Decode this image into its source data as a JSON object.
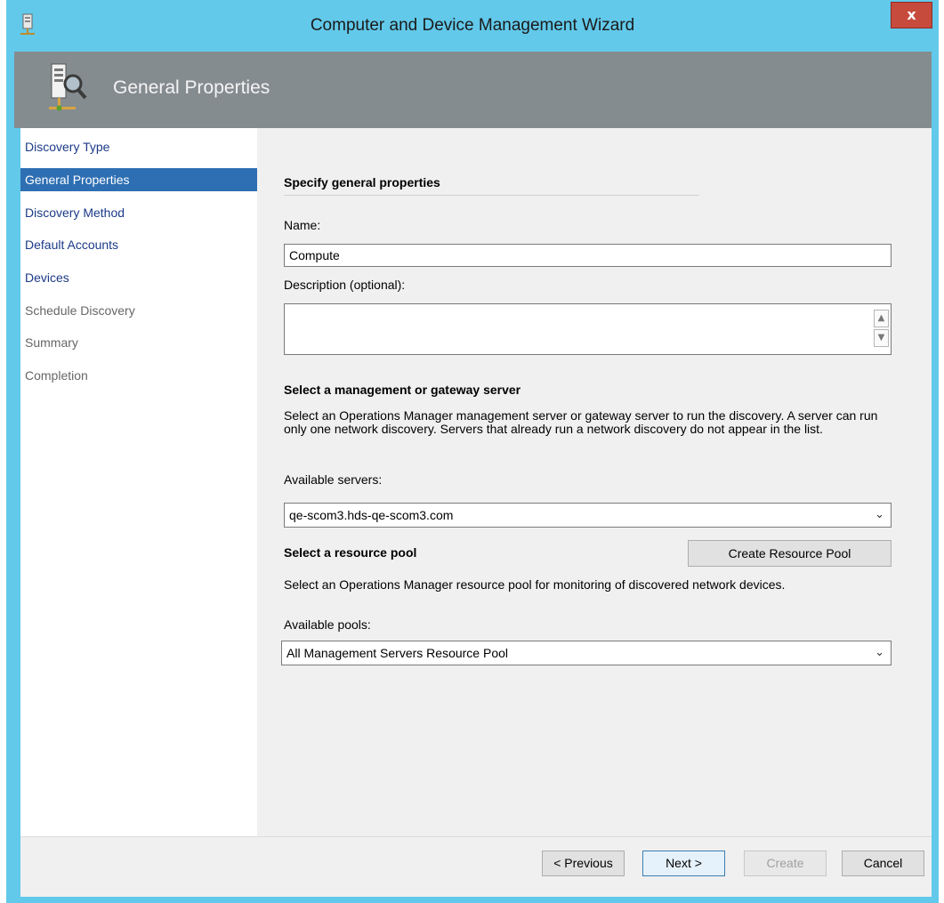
{
  "window": {
    "title": "Computer and Device Management Wizard",
    "close_label": "x",
    "icons": {
      "app": "server-icon",
      "header": "server-search-icon"
    }
  },
  "header": {
    "title": "General Properties"
  },
  "sidebar": {
    "items": [
      {
        "label": "Discovery Type",
        "state": "enabled"
      },
      {
        "label": "General Properties",
        "state": "selected"
      },
      {
        "label": "Discovery Method",
        "state": "enabled"
      },
      {
        "label": "Default Accounts",
        "state": "enabled"
      },
      {
        "label": "Devices",
        "state": "enabled"
      },
      {
        "label": "Schedule Discovery",
        "state": "disabled"
      },
      {
        "label": "Summary",
        "state": "disabled"
      },
      {
        "label": "Completion",
        "state": "disabled"
      }
    ]
  },
  "main": {
    "section_title": "Specify general properties",
    "name_label": "Name:",
    "name_value": "Compute",
    "description_label": "Description (optional):",
    "description_value": "",
    "server_section_title": "Select a management or gateway server",
    "server_description": "Select an Operations Manager management server or gateway server to run the discovery. A server can run only one network discovery. Servers that already run a network discovery do not appear in the list.",
    "available_servers_label": "Available servers:",
    "available_servers_value": "qe-scom3.hds-qe-scom3.com",
    "pool_section_title": "Select a resource pool",
    "create_pool_label": "Create Resource Pool",
    "pool_description": "Select an Operations Manager resource pool for monitoring of discovered network devices.",
    "available_pools_label": "Available pools:",
    "available_pools_value": "All Management Servers Resource Pool"
  },
  "footer": {
    "previous_label": "< Previous",
    "next_label": "Next >",
    "create_label": "Create",
    "cancel_label": "Cancel"
  },
  "colors": {
    "window_frame": "#62c9ea",
    "header_band": "#858c90",
    "selected_nav": "#2e6fb3",
    "nav_link": "#1b3a87",
    "close_button": "#c74b3c"
  }
}
